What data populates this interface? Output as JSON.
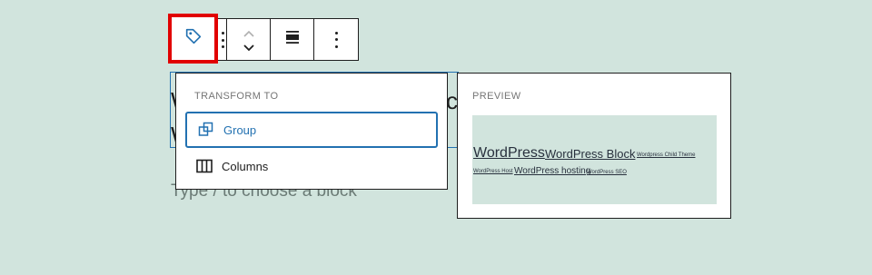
{
  "toolbar": {
    "block_type_icon": "tag-icon",
    "drag_icon": "drag-handle-icon",
    "move_up_icon": "chevron-up-icon",
    "move_down_icon": "chevron-down-icon",
    "align_icon": "align-center-icon",
    "options_icon": "more-vertical-icon",
    "highlight_color": "#e10000"
  },
  "background": {
    "line1_start": "W",
    "line1_end": "c",
    "line2_start": "W",
    "placeholder": "Type / to choose a block"
  },
  "transform_menu": {
    "heading": "TRANSFORM TO",
    "items": [
      {
        "label": "Group",
        "icon": "group-icon",
        "selected": true
      },
      {
        "label": "Columns",
        "icon": "columns-icon",
        "selected": false
      }
    ],
    "accent_color": "#2271b1"
  },
  "preview": {
    "heading": "PREVIEW",
    "tags": [
      {
        "label": "WordPress"
      },
      {
        "label": "WordPress Block"
      },
      {
        "label": "Wordpress Child Theme"
      },
      {
        "label": "WordPress Host"
      },
      {
        "label": "WordPress hosting"
      },
      {
        "label": "WordPress SEO"
      }
    ]
  }
}
